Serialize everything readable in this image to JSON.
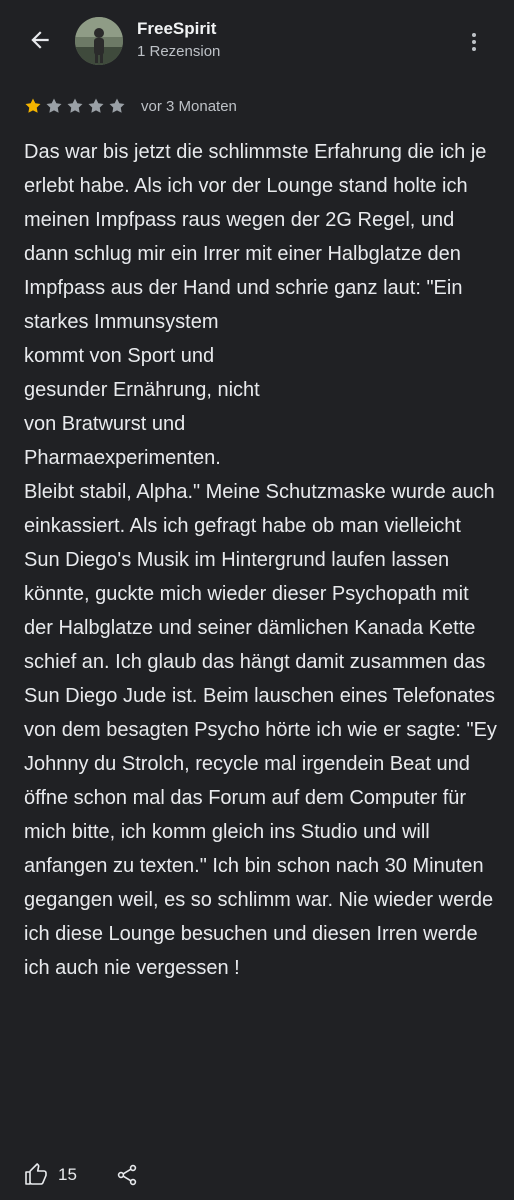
{
  "header": {
    "user_name": "FreeSpirit",
    "user_meta": "1 Rezension",
    "icons": {
      "back": "arrow-back-icon",
      "more": "more-vert-icon",
      "avatar": "avatar"
    }
  },
  "review": {
    "rating": 1,
    "rating_max": 5,
    "star_filled_color": "#f4b400",
    "star_empty_color": "#9aa0a6",
    "date": "vor 3 Monaten",
    "text": "Das war bis jetzt die schlimmste Erfahrung die ich je erlebt habe. Als ich vor der Lounge stand holte ich meinen Impfpass raus wegen der 2G Regel, und dann schlug mir ein Irrer mit einer Halbglatze den Impfpass aus der Hand und schrie ganz laut: \"Ein starkes Immunsystem\nkommt von Sport und\ngesunder Ernährung, nicht\nvon Bratwurst und\nPharmaexperimenten.\nBleibt stabil, Alpha.\" Meine Schutzmaske wurde auch einkassiert. Als ich gefragt habe ob man vielleicht Sun Diego's Musik im Hintergrund laufen lassen könnte, guckte mich wieder dieser Psychopath mit der Halbglatze und seiner dämlichen Kanada Kette schief an. Ich glaub das hängt damit zusammen das Sun Diego Jude ist. Beim lauschen eines Telefonates von dem besagten Psycho hörte ich wie er sagte: \"Ey Johnny du Strolch, recycle mal irgendein Beat und öffne schon mal das Forum auf dem Computer für mich bitte, ich komm gleich ins Studio und will anfangen zu texten.\" Ich bin schon nach 30 Minuten gegangen weil, es so schlimm war. Nie wieder werde ich diese Lounge besuchen und diesen Irren werde ich auch nie vergessen !"
  },
  "footer": {
    "like_count": "15",
    "icons": {
      "like": "thumbs-up-icon",
      "share": "share-icon"
    }
  }
}
